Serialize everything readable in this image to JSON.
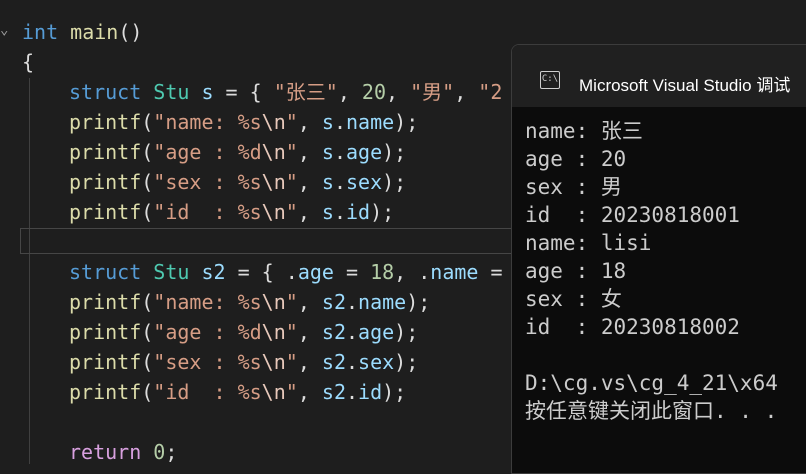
{
  "editor": {
    "line1": {
      "kw": "int",
      "fn": "main",
      "rest": "()"
    },
    "line2": "{",
    "line3": {
      "kw": "struct",
      "ty": "Stu",
      "var": "s",
      "eq": " = { ",
      "s1": "\"张三\"",
      "c1": ", ",
      "n1": "20",
      "c2": ", ",
      "s2": "\"男\"",
      "c3": ", ",
      "s3": "\"2"
    },
    "line4": {
      "fn": "printf",
      "p1": "(",
      "s1": "\"name: %s",
      "esc": "\\n",
      "s2": "\"",
      "c": ", ",
      "v1": "s",
      "dot": ".",
      "v2": "name",
      "end": ");"
    },
    "line5": {
      "fn": "printf",
      "p1": "(",
      "s1": "\"age : %d",
      "esc": "\\n",
      "s2": "\"",
      "c": ", ",
      "v1": "s",
      "dot": ".",
      "v2": "age",
      "end": ");"
    },
    "line6": {
      "fn": "printf",
      "p1": "(",
      "s1": "\"sex : %s",
      "esc": "\\n",
      "s2": "\"",
      "c": ", ",
      "v1": "s",
      "dot": ".",
      "v2": "sex",
      "end": ");"
    },
    "line7": {
      "fn": "printf",
      "p1": "(",
      "s1": "\"id  : %s",
      "esc": "\\n",
      "s2": "\"",
      "c": ", ",
      "v1": "s",
      "dot": ".",
      "v2": "id",
      "end": ");"
    },
    "line9": {
      "kw": "struct",
      "ty": "Stu",
      "var": "s2",
      "eq": " = { .",
      "f1": "age",
      "eq2": " = ",
      "n1": "18",
      "c1": ", .",
      "f2": "name",
      "eq3": " ="
    },
    "line10": {
      "fn": "printf",
      "p1": "(",
      "s1": "\"name: %s",
      "esc": "\\n",
      "s2": "\"",
      "c": ", ",
      "v1": "s2",
      "dot": ".",
      "v2": "name",
      "end": ");"
    },
    "line11": {
      "fn": "printf",
      "p1": "(",
      "s1": "\"age : %d",
      "esc": "\\n",
      "s2": "\"",
      "c": ", ",
      "v1": "s2",
      "dot": ".",
      "v2": "age",
      "end": ");"
    },
    "line12": {
      "fn": "printf",
      "p1": "(",
      "s1": "\"sex : %s",
      "esc": "\\n",
      "s2": "\"",
      "c": ", ",
      "v1": "s2",
      "dot": ".",
      "v2": "sex",
      "end": ");"
    },
    "line13": {
      "fn": "printf",
      "p1": "(",
      "s1": "\"id  : %s",
      "esc": "\\n",
      "s2": "\"",
      "c": ", ",
      "v1": "s2",
      "dot": ".",
      "v2": "id",
      "end": ");"
    },
    "line15": {
      "kw": "return",
      "n": "0",
      "end": ";"
    }
  },
  "console": {
    "title": "Microsoft Visual Studio 调试",
    "icon": "terminal-icon",
    "icon_glyph": "C:\\",
    "lines": [
      "name: 张三",
      "age : 20",
      "sex : 男",
      "id  : 20230818001",
      "name: lisi",
      "age : 18",
      "sex : 女",
      "id  : 20230818002",
      "",
      "D:\\cg.vs\\cg_4_21\\x64",
      "按任意键关闭此窗口. . ."
    ]
  },
  "colors": {
    "editor_bg": "#1e1e1e",
    "keyword": "#569cd6",
    "type": "#4ec9b0",
    "function": "#dcdcaa",
    "string": "#d69d85",
    "variable": "#9cdcfe",
    "number": "#b5cea8",
    "control_keyword": "#d8a0df",
    "console_bg": "#0c0c0c",
    "console_title_bg": "#202020"
  }
}
